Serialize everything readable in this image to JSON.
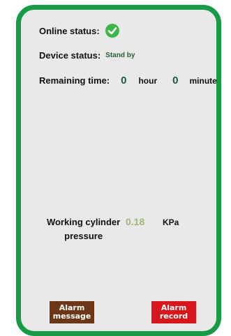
{
  "online_status": {
    "label": "Online status:",
    "icon": "check-circle-icon",
    "color": "#3db54a"
  },
  "device_status": {
    "label": "Device status:",
    "value": "Stand by"
  },
  "remaining_time": {
    "label": "Remaining time:",
    "hours": "0",
    "hour_unit": "hour",
    "minutes": "0",
    "minute_unit": "minute"
  },
  "pressure": {
    "label_line1": "Working cylinder",
    "label_line2": "pressure",
    "value": "0.18",
    "unit": "KPa"
  },
  "buttons": {
    "alarm_message": {
      "line1": "Alarm",
      "line2": "message",
      "color": "#6b3718"
    },
    "alarm_record": {
      "line1": "Alarm",
      "line2": "record",
      "color": "#d9161b"
    }
  },
  "frame_color": "#199a46"
}
